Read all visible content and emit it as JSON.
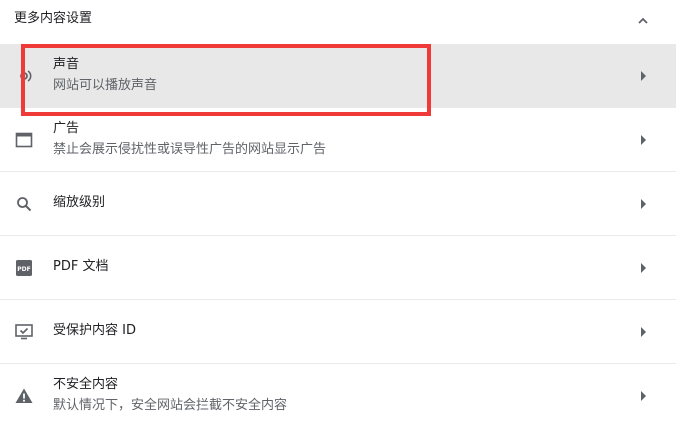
{
  "section": {
    "title": "更多内容设置",
    "collapse_icon": "chevron-up-icon"
  },
  "rows": [
    {
      "id": "sound",
      "title": "声音",
      "subtitle": "网站可以播放声音",
      "icon": "speaker-icon",
      "highlighted": true
    },
    {
      "id": "ads",
      "title": "广告",
      "subtitle": "禁止会展示侵扰性或误导性广告的网站显示广告",
      "icon": "ad-window-icon"
    },
    {
      "id": "zoom",
      "title": "缩放级别",
      "icon": "search-icon"
    },
    {
      "id": "pdf",
      "title": "PDF 文档",
      "icon": "pdf-icon",
      "icon_text": "PDF"
    },
    {
      "id": "protected",
      "title": "受保护内容 ID",
      "icon": "protected-monitor-icon"
    },
    {
      "id": "insecure",
      "title": "不安全内容",
      "subtitle": "默认情况下，安全网站会拦截不安全内容",
      "icon": "warning-icon"
    }
  ],
  "colors": {
    "highlight_border": "#f03a3a",
    "highlight_row_bg": "#e8e8e8",
    "icon": "#5f6368"
  }
}
